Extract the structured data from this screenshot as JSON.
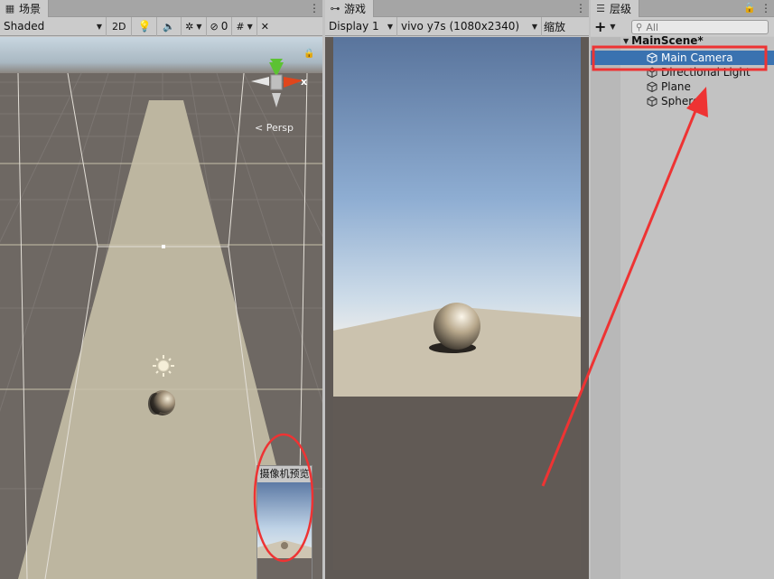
{
  "scene": {
    "tab_label": "场景",
    "shading_mode": "Shaded",
    "mode_2d": "2D",
    "hidden_count": "0",
    "persp_label": "Persp",
    "gizmo_axis": "x",
    "camera_preview_title": "摄像机预览"
  },
  "game": {
    "tab_label": "游戏",
    "display": "Display 1",
    "resolution": "vivo y7s (1080x2340)",
    "scale_label": "缩放"
  },
  "hierarchy": {
    "tab_label": "层级",
    "add_label": "+",
    "search_placeholder": "All",
    "scene_name": "MainScene*",
    "items": [
      {
        "label": "Main Camera"
      },
      {
        "label": "Directional Light"
      },
      {
        "label": "Plane"
      },
      {
        "label": "Sphere"
      }
    ]
  },
  "colors": {
    "selection": "#3a72b0",
    "annotation": "#ee3333"
  }
}
